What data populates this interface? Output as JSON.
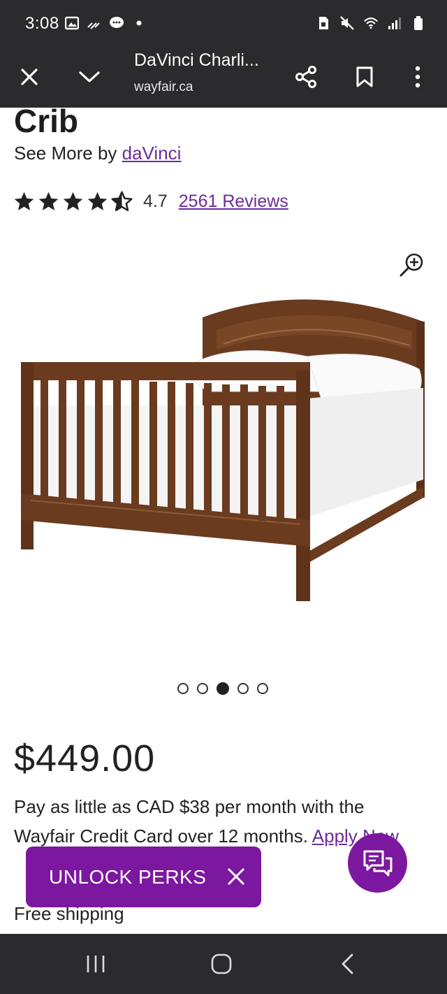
{
  "status_bar": {
    "time": "3:08",
    "icons_left": [
      "image-icon",
      "wifi-calling-icon",
      "message-icon",
      "dot-icon"
    ],
    "icons_right": [
      "sim-icon",
      "mute-icon",
      "wifi-icon",
      "signal-icon",
      "battery-icon"
    ]
  },
  "toolbar": {
    "title": "DaVinci Charli...",
    "url": "wayfair.ca"
  },
  "product": {
    "title": "Crib",
    "see_more_prefix": "See More by ",
    "brand": "daVinci",
    "rating": "4.7",
    "rating_stars": 4.7,
    "reviews": "2561 Reviews",
    "price": "$449.00",
    "credit_text": "Pay as little as CAD $38 per month with the Wayfair Credit Card over 12 months. ",
    "credit_link": "Apply Now",
    "shipping": "Free shipping"
  },
  "carousel": {
    "count": 5,
    "active_index": 2
  },
  "perks": {
    "label": "UNLOCK PERKS"
  },
  "colors": {
    "accent": "#7b189f",
    "link": "#6b2d9a",
    "chrome": "#2b2b2e",
    "wood": "#6a3b1f"
  }
}
